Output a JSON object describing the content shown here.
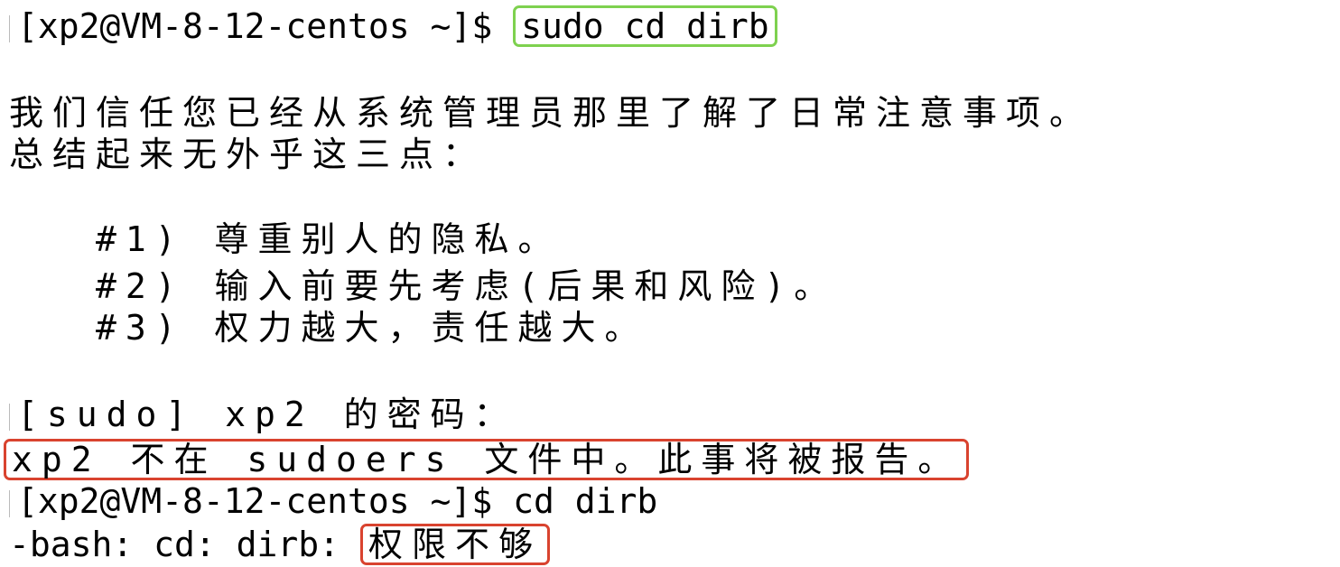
{
  "terminal": {
    "prompt1": "[xp2@VM-8-12-centos ~]$ ",
    "command1": "sudo cd dirb",
    "lecture_line1": "我们信任您已经从系统管理员那里了解了日常注意事项。",
    "lecture_line2": "总结起来无外乎这三点：",
    "rule1": "#1) 尊重别人的隐私。",
    "rule2": "#2) 输入前要先考虑(后果和风险)。",
    "rule3": "#3) 权力越大，责任越大。",
    "sudo_prompt": "[sudo] xp2 的密码：",
    "sudoers_error": "xp2 不在 sudoers 文件中。此事将被报告。",
    "prompt2": "[xp2@VM-8-12-centos ~]$ ",
    "command2": "cd dirb",
    "bash_error_prefix": "-bash: cd: dirb: ",
    "bash_error_message": "权限不够"
  },
  "colors": {
    "highlight_success": "#7ed14f",
    "highlight_error": "#d9432f",
    "text": "#000000",
    "background": "#ffffff"
  }
}
